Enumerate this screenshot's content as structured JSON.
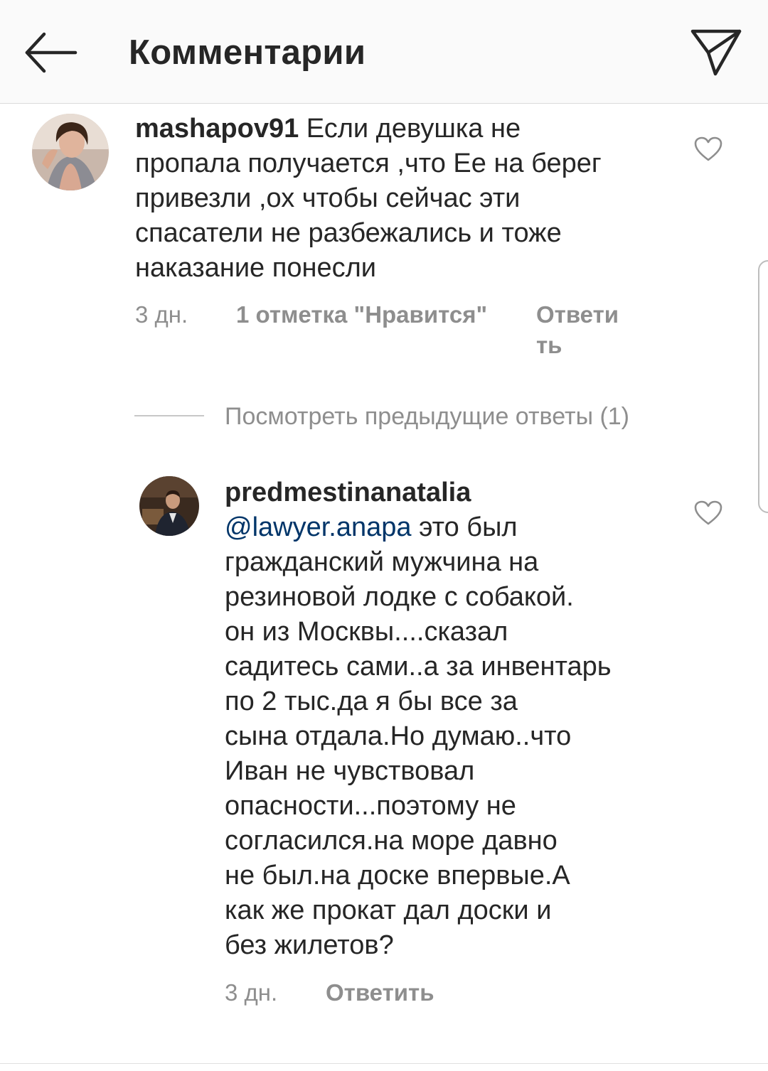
{
  "header": {
    "title": "Комментарии",
    "back_icon": "arrow-left-icon",
    "send_icon": "paper-plane-icon"
  },
  "comments": [
    {
      "username": "mashapov91",
      "text_lines": [
        "Если девушка не",
        "пропала получается ,что Ее на берег",
        "привезли ,ох чтобы сейчас эти",
        "спасатели не разбежались и тоже",
        "наказание понесли"
      ],
      "time": "3 дн.",
      "likes": "1 отметка \"Нравится\"",
      "reply_line1": "Ответи",
      "reply_line2": "ть"
    },
    {
      "username": "predmestinanatalia",
      "mention": "@lawyer.anapa",
      "text_lines": [
        "это был",
        "гражданский мужчина на",
        "резиновой лодке с собакой.",
        "он из Москвы....сказал",
        "садитесь сами..а за инвентарь",
        "по 2 тыс.да я бы все за",
        "сына отдала.Но думаю..что",
        "Иван не чувствовал",
        "опасности...поэтому не",
        "согласился.на море давно",
        "не был.на доске впервые.А",
        "как же прокат дал доски и",
        "без жилетов?"
      ],
      "time": "3 дн.",
      "reply": "Ответить"
    }
  ],
  "view_replies": "Посмотреть предыдущие ответы (1)",
  "colors": {
    "header_bg": "#fafafa",
    "text": "#262626",
    "muted": "#8e8e8e",
    "mention": "#003569"
  }
}
